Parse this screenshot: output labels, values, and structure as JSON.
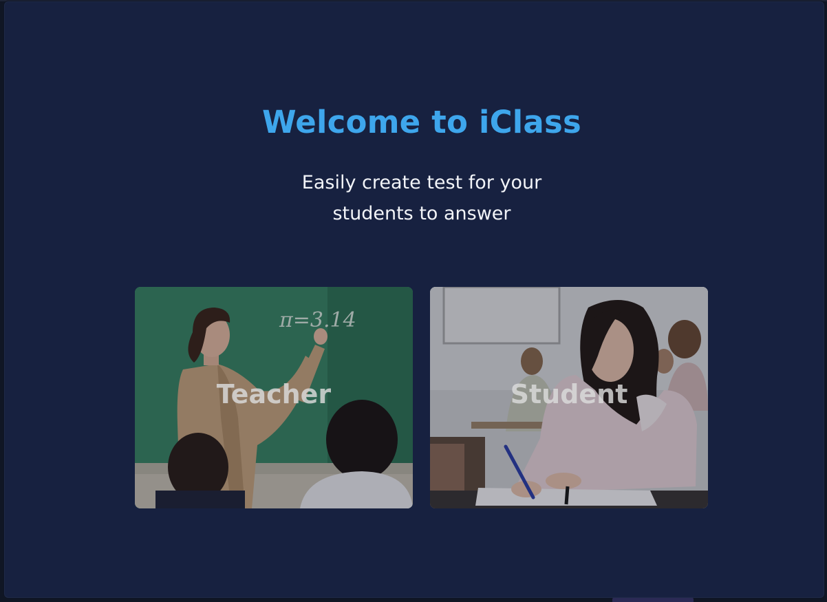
{
  "header": {
    "title": "Welcome to iClass",
    "subtitle": "Easily create test for your students to answer"
  },
  "roles": [
    {
      "label": "Teacher",
      "image": "teacher-at-chalkboard",
      "chalk_text": "π=3.14"
    },
    {
      "label": "Student",
      "image": "student-writing-at-desk"
    }
  ],
  "colors": {
    "background": "#172140",
    "title": "#3ea6ec",
    "subtitle": "#f2f4f8"
  }
}
